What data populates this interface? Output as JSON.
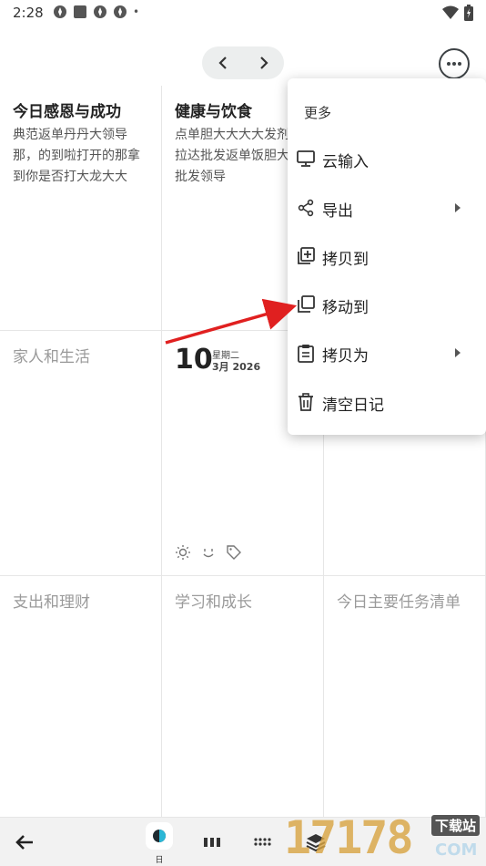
{
  "status_bar": {
    "time": "2:28",
    "dot": "•",
    "left_icons": [
      "app-notification-icon",
      "square-notification-icon",
      "app-notification-icon",
      "app-notification-icon"
    ],
    "right_icons": [
      "wifi-icon",
      "battery-charging-icon"
    ]
  },
  "toolbar": {
    "prev_icon": "chevron-left-icon",
    "next_icon": "chevron-right-icon",
    "more_icon": "more-horizontal-icon"
  },
  "grid": {
    "cells": [
      {
        "title": "今日感恩与成功",
        "body": "典范返单丹丹大领导那，的到啦打开的那拿到你是否打大龙大大"
      },
      {
        "title": "健康与饮食",
        "body": "点单胆大大大大发剂飞拉达批发返单饭胆大打批发领导"
      },
      {
        "title": ""
      },
      {
        "title": "家人和生活"
      },
      {
        "title": ""
      },
      {
        "title": ""
      },
      {
        "title": "支出和理财"
      },
      {
        "title": "学习和成长"
      },
      {
        "title": "今日主要任务清单"
      }
    ],
    "date": {
      "day": "10",
      "weekday": "星期二",
      "month_year": "3月 2026",
      "icons": [
        "weather-sun-icon",
        "mood-smile-icon",
        "tag-icon"
      ]
    }
  },
  "menu": {
    "header": "更多",
    "items": [
      {
        "label": "云输入",
        "icon": "monitor-icon",
        "submenu": false
      },
      {
        "label": "导出",
        "icon": "share-icon",
        "submenu": true
      },
      {
        "label": "拷贝到",
        "icon": "copy-add-icon",
        "submenu": false
      },
      {
        "label": "移动到",
        "icon": "move-copy-icon",
        "submenu": false
      },
      {
        "label": "拷贝为",
        "icon": "clipboard-icon",
        "submenu": true
      },
      {
        "label": "清空日记",
        "icon": "trash-icon",
        "submenu": false
      }
    ]
  },
  "bottom_bar": {
    "back_icon": "arrow-left-icon",
    "day_label": "日",
    "icons": [
      "day-view-icon",
      "week-view-icon",
      "month-view-icon",
      "layers-icon"
    ]
  },
  "watermark": {
    "digits": "17178",
    "badge": "下载站",
    "suffix": "COM"
  },
  "colors": {
    "annotation": "#e02020",
    "divider": "#e6e6e6",
    "bottom_bar": "#f2f2f2"
  }
}
